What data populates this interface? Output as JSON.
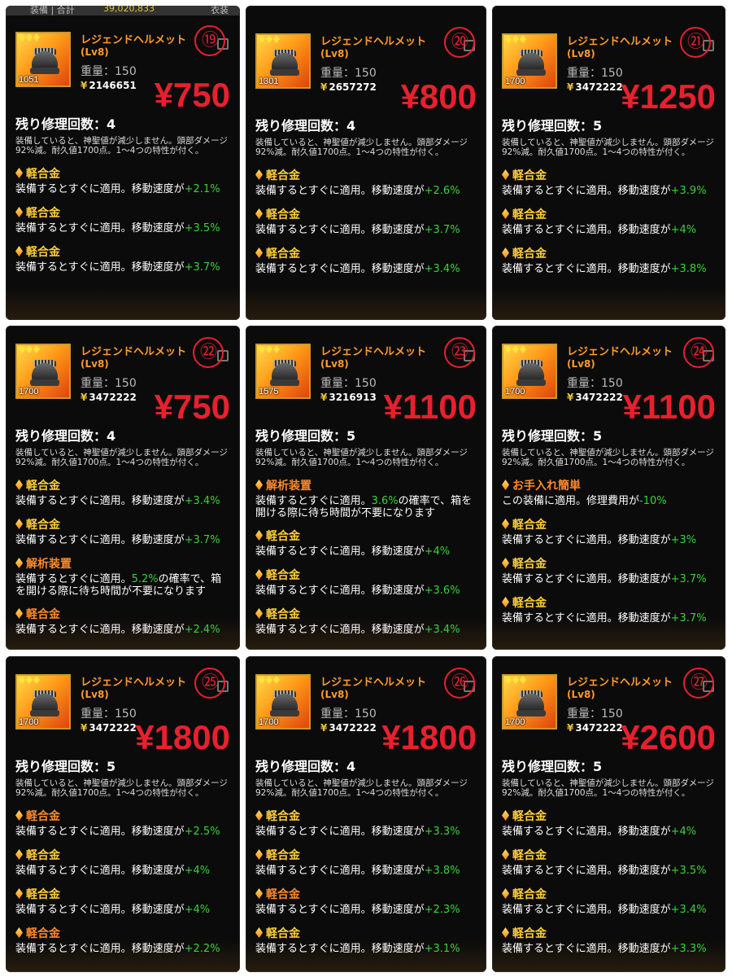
{
  "top_strip": {
    "left_text": "装備 | 合計",
    "amount": "39,020,833",
    "right_text": "衣装"
  },
  "panels": [
    {
      "number": "⑲",
      "name": "レジェンドヘルメット",
      "level": "(Lv8)",
      "durability": "1051",
      "weight": "重量：150",
      "price": "2146651",
      "sale": "¥750",
      "repair": "残り修理回数：4",
      "desc": "装備していると、神聖値が減少しません。頭部ダメージ92%減。耐久値1700点。1〜4つの特性が付く。",
      "traits": [
        {
          "name": "軽合金",
          "orange": false,
          "pre": "装備するとすぐに適用。移動速度が",
          "num": "+2.1%",
          "post": ""
        },
        {
          "name": "軽合金",
          "orange": false,
          "pre": "装備するとすぐに適用。移動速度が",
          "num": "+3.5%",
          "post": ""
        },
        {
          "name": "軽合金",
          "orange": false,
          "pre": "装備するとすぐに適用。移動速度が",
          "num": "+3.7%",
          "post": ""
        }
      ]
    },
    {
      "number": "⑳",
      "name": "レジェンドヘルメット",
      "level": "(Lv8)",
      "durability": "1301",
      "weight": "重量：150",
      "price": "2657272",
      "sale": "¥800",
      "repair": "残り修理回数：4",
      "desc": "装備していると、神聖値が減少しません。頭部ダメージ92%減。耐久値1700点。1〜4つの特性が付く。",
      "traits": [
        {
          "name": "軽合金",
          "orange": false,
          "pre": "装備するとすぐに適用。移動速度が",
          "num": "+2.6%",
          "post": ""
        },
        {
          "name": "軽合金",
          "orange": false,
          "pre": "装備するとすぐに適用。移動速度が",
          "num": "+3.7%",
          "post": ""
        },
        {
          "name": "軽合金",
          "orange": false,
          "pre": "装備するとすぐに適用。移動速度が",
          "num": "+3.4%",
          "post": ""
        }
      ]
    },
    {
      "number": "㉑",
      "name": "レジェンドヘルメット",
      "level": "(Lv8)",
      "durability": "1700",
      "weight": "重量：150",
      "price": "3472222",
      "sale": "¥1250",
      "repair": "残り修理回数：5",
      "desc": "装備していると、神聖値が減少しません。頭部ダメージ92%減。耐久値1700点。1〜4つの特性が付く。",
      "traits": [
        {
          "name": "軽合金",
          "orange": false,
          "pre": "装備するとすぐに適用。移動速度が",
          "num": "+3.9%",
          "post": ""
        },
        {
          "name": "軽合金",
          "orange": false,
          "pre": "装備するとすぐに適用。移動速度が",
          "num": "+4%",
          "post": ""
        },
        {
          "name": "軽合金",
          "orange": false,
          "pre": "装備するとすぐに適用。移動速度が",
          "num": "+3.8%",
          "post": ""
        }
      ]
    },
    {
      "number": "㉒",
      "name": "レジェンドヘルメット",
      "level": "(Lv8)",
      "durability": "1700",
      "weight": "重量：150",
      "price": "3472222",
      "sale": "¥750",
      "repair": "残り修理回数：4",
      "desc": "装備していると、神聖値が減少しません。頭部ダメージ92%減。耐久値1700点。1〜4つの特性が付く。",
      "traits": [
        {
          "name": "軽合金",
          "orange": false,
          "pre": "装備するとすぐに適用。移動速度が",
          "num": "+3.4%",
          "post": ""
        },
        {
          "name": "軽合金",
          "orange": false,
          "pre": "装備するとすぐに適用。移動速度が",
          "num": "+3.7%",
          "post": ""
        },
        {
          "name": "解析装置",
          "orange": true,
          "pre": "装備するとすぐに適用。",
          "num": "5.2%",
          "post": "の確率で、箱を開ける際に待ち時間が不要になります",
          "two": true
        },
        {
          "name": "軽合金",
          "orange": true,
          "pre": "装備するとすぐに適用。移動速度が",
          "num": "+2.4%",
          "post": ""
        }
      ]
    },
    {
      "number": "㉓",
      "name": "レジェンドヘルメット",
      "level": "(Lv8)",
      "durability": "1575",
      "weight": "重量：150",
      "price": "3216913",
      "sale": "¥1100",
      "repair": "残り修理回数：5",
      "desc": "装備していると、神聖値が減少しません。頭部ダメージ92%減。耐久値1700点。1〜4つの特性が付く。",
      "traits": [
        {
          "name": "解析装置",
          "orange": true,
          "pre": "装備するとすぐに適用。",
          "num": "3.6%",
          "post": "の確率で、箱を開ける際に待ち時間が不要になります",
          "two": true
        },
        {
          "name": "軽合金",
          "orange": false,
          "pre": "装備するとすぐに適用。移動速度が",
          "num": "+4%",
          "post": ""
        },
        {
          "name": "軽合金",
          "orange": false,
          "pre": "装備するとすぐに適用。移動速度が",
          "num": "+3.6%",
          "post": ""
        },
        {
          "name": "軽合金",
          "orange": false,
          "pre": "装備するとすぐに適用。移動速度が",
          "num": "+3.4%",
          "post": ""
        }
      ]
    },
    {
      "number": "㉔",
      "name": "レジェンドヘルメット",
      "level": "(Lv8)",
      "durability": "1700",
      "weight": "重量：150",
      "price": "3472222",
      "sale": "¥1100",
      "repair": "残り修理回数：5",
      "desc": "装備していると、神聖値が減少しません。頭部ダメージ92%減。耐久値1700点。1〜4つの特性が付く。",
      "traits": [
        {
          "name": "お手入れ簡単",
          "orange": true,
          "pre": "この装備に適用。修理費用が",
          "num": "-10%",
          "post": ""
        },
        {
          "name": "軽合金",
          "orange": false,
          "pre": "装備するとすぐに適用。移動速度が",
          "num": "+3%",
          "post": ""
        },
        {
          "name": "軽合金",
          "orange": false,
          "pre": "装備するとすぐに適用。移動速度が",
          "num": "+3.7%",
          "post": ""
        },
        {
          "name": "軽合金",
          "orange": false,
          "pre": "装備するとすぐに適用。移動速度が",
          "num": "+3.7%",
          "post": ""
        }
      ]
    },
    {
      "number": "㉕",
      "name": "レジェンドヘルメット",
      "level": "(Lv8)",
      "durability": "1700",
      "weight": "重量：150",
      "price": "3472222",
      "sale": "¥1800",
      "repair": "残り修理回数：5",
      "desc": "装備していると、神聖値が減少しません。頭部ダメージ92%減。耐久値1700点。1〜4つの特性が付く。",
      "traits": [
        {
          "name": "軽合金",
          "orange": true,
          "pre": "装備するとすぐに適用。移動速度が",
          "num": "+2.5%",
          "post": ""
        },
        {
          "name": "軽合金",
          "orange": false,
          "pre": "装備するとすぐに適用。移動速度が",
          "num": "+4%",
          "post": ""
        },
        {
          "name": "軽合金",
          "orange": false,
          "pre": "装備するとすぐに適用。移動速度が",
          "num": "+4%",
          "post": ""
        },
        {
          "name": "軽合金",
          "orange": true,
          "pre": "装備するとすぐに適用。移動速度が",
          "num": "+2.2%",
          "post": ""
        }
      ]
    },
    {
      "number": "㉖",
      "name": "レジェンドヘルメット",
      "level": "(Lv8)",
      "durability": "1700",
      "weight": "重量：150",
      "price": "3472222",
      "sale": "¥1800",
      "repair": "残り修理回数：4",
      "desc": "装備していると、神聖値が減少しません。頭部ダメージ92%減。耐久値1700点。1〜4つの特性が付く。",
      "traits": [
        {
          "name": "軽合金",
          "orange": false,
          "pre": "装備するとすぐに適用。移動速度が",
          "num": "+3.3%",
          "post": ""
        },
        {
          "name": "軽合金",
          "orange": false,
          "pre": "装備するとすぐに適用。移動速度が",
          "num": "+3.8%",
          "post": ""
        },
        {
          "name": "軽合金",
          "orange": true,
          "pre": "装備するとすぐに適用。移動速度が",
          "num": "+2.3%",
          "post": ""
        },
        {
          "name": "軽合金",
          "orange": false,
          "pre": "装備するとすぐに適用。移動速度が",
          "num": "+3.1%",
          "post": ""
        }
      ]
    },
    {
      "number": "㉗",
      "name": "レジェンドヘルメット",
      "level": "(Lv8)",
      "durability": "1700",
      "weight": "重量：150",
      "price": "3472222",
      "sale": "¥2600",
      "repair": "残り修理回数：5",
      "desc": "装備していると、神聖値が減少しません。頭部ダメージ92%減。耐久値1700点。1〜4つの特性が付く。",
      "traits": [
        {
          "name": "軽合金",
          "orange": false,
          "pre": "装備するとすぐに適用。移動速度が",
          "num": "+4%",
          "post": ""
        },
        {
          "name": "軽合金",
          "orange": false,
          "pre": "装備するとすぐに適用。移動速度が",
          "num": "+3.5%",
          "post": ""
        },
        {
          "name": "軽合金",
          "orange": false,
          "pre": "装備するとすぐに適用。移動速度が",
          "num": "+3.4%",
          "post": ""
        },
        {
          "name": "軽合金",
          "orange": false,
          "pre": "装備するとすぐに適用。移動速度が",
          "num": "+3.3%",
          "post": ""
        }
      ]
    }
  ]
}
